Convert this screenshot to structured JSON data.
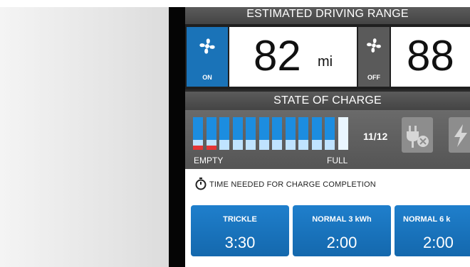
{
  "range": {
    "title": "ESTIMATED DRIVING RANGE",
    "fan_on": {
      "icon": "fan-icon",
      "label": "ON",
      "color": "#1a73b8"
    },
    "fan_off": {
      "icon": "fan-icon",
      "label": "OFF",
      "color": "#5a5a5a"
    },
    "on_value": "82",
    "on_unit": "mi",
    "off_value": "88"
  },
  "charge": {
    "title": "STATE OF CHARGE",
    "bars_total": 12,
    "bars_filled": 11,
    "count_text": "11/12",
    "empty_label": "EMPTY",
    "full_label": "FULL",
    "plug_icon": "unplug-icon",
    "bolt_icon": "bolt-icon",
    "bar_color": "#1c8de0",
    "warning_color": "#e53535"
  },
  "time_needed": {
    "icon": "stopwatch-icon",
    "label": "TIME NEEDED FOR CHARGE COMPLETION"
  },
  "modes": [
    {
      "name": "TRICKLE",
      "time": "3:30"
    },
    {
      "name": "NORMAL  3 kWh",
      "time": "2:00"
    },
    {
      "name": "NORMAL  6 k",
      "time": "2:00"
    }
  ]
}
